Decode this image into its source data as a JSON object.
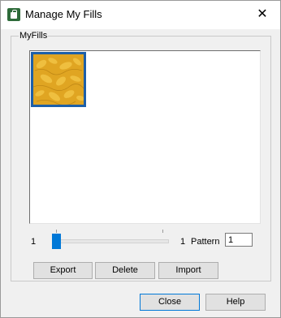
{
  "window": {
    "title": "Manage My Fills",
    "app_icon": "fill-jar-icon",
    "close_glyph": "✕"
  },
  "group": {
    "label": "MyFills"
  },
  "list": {
    "items": [
      {
        "type": "fill-pattern-thumbnail",
        "color": "#e0a522",
        "selected": true
      }
    ]
  },
  "slider": {
    "min_label": "1",
    "max_label": "1",
    "value": 1,
    "min": 1,
    "max": 1
  },
  "pattern": {
    "label": "Pattern",
    "value": "1"
  },
  "buttons": {
    "export": "Export",
    "delete": "Delete",
    "import": "Import",
    "close": "Close",
    "help": "Help"
  },
  "colors": {
    "accent": "#0078d7",
    "selection_border": "#1d5fa8",
    "fill": "#e0a522"
  }
}
